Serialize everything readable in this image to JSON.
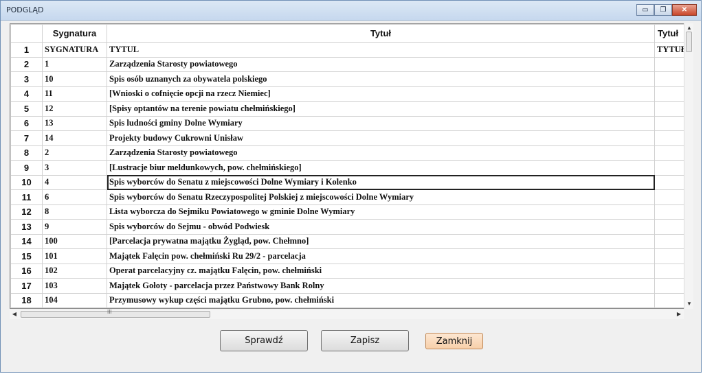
{
  "window": {
    "title": "PODGLĄD"
  },
  "controls": {
    "minimize": "▭",
    "restore": "❐",
    "close": "✕"
  },
  "grid": {
    "headers": [
      "",
      "Sygnatura",
      "Tytuł",
      "Tytuł"
    ],
    "rows": [
      {
        "n": "1",
        "sygnatura": "SYGNATURA",
        "tytul": "TYTUL",
        "extra": "TYTUŁ"
      },
      {
        "n": "2",
        "sygnatura": "1",
        "tytul": "Zarządzenia Starosty powiatowego",
        "extra": ""
      },
      {
        "n": "3",
        "sygnatura": "10",
        "tytul": "Spis osób uznanych za obywatela polskiego",
        "extra": ""
      },
      {
        "n": "4",
        "sygnatura": "11",
        "tytul": "[Wnioski o cofnięcie opcji na rzecz Niemiec]",
        "extra": ""
      },
      {
        "n": "5",
        "sygnatura": "12",
        "tytul": "[Spisy optantów na terenie powiatu chełmińskiego]",
        "extra": ""
      },
      {
        "n": "6",
        "sygnatura": "13",
        "tytul": "Spis ludności gminy Dolne Wymiary",
        "extra": ""
      },
      {
        "n": "7",
        "sygnatura": "14",
        "tytul": "Projekty budowy Cukrowni Unisław",
        "extra": ""
      },
      {
        "n": "8",
        "sygnatura": "2",
        "tytul": "Zarządzenia Starosty powiatowego",
        "extra": ""
      },
      {
        "n": "9",
        "sygnatura": "3",
        "tytul": "[Lustracje biur meldunkowych, pow. chełmińskiego]",
        "extra": ""
      },
      {
        "n": "10",
        "sygnatura": "4",
        "tytul": "Spis wyborców do Senatu z miejscowości Dolne Wymiary i Kolenko",
        "extra": ""
      },
      {
        "n": "11",
        "sygnatura": "6",
        "tytul": "Spis wyborców do Senatu Rzeczypospolitej Polskiej z miejscowości Dolne Wymiary",
        "extra": ""
      },
      {
        "n": "12",
        "sygnatura": "8",
        "tytul": "Lista wyborcza do Sejmiku Powiatowego w gminie Dolne Wymiary",
        "extra": ""
      },
      {
        "n": "13",
        "sygnatura": "9",
        "tytul": "Spis wyborców do Sejmu - obwód Podwiesk",
        "extra": ""
      },
      {
        "n": "14",
        "sygnatura": "100",
        "tytul": "[Parcelacja prywatna majątku Żygląd, pow. Chełmno]",
        "extra": ""
      },
      {
        "n": "15",
        "sygnatura": "101",
        "tytul": "Majątek Falęcin pow. chełmiński Ru 29/2 - parcelacja",
        "extra": ""
      },
      {
        "n": "16",
        "sygnatura": "102",
        "tytul": "Operat parcelacyjny cz. majątku Falęcin, pow. chełmiński",
        "extra": ""
      },
      {
        "n": "17",
        "sygnatura": "103",
        "tytul": "Majątek Gołoty - parcelacja przez Państwowy Bank Rolny",
        "extra": ""
      },
      {
        "n": "18",
        "sygnatura": "104",
        "tytul": "Przymusowy wykup części majątku Grubno, pow. chełmiński",
        "extra": ""
      }
    ],
    "selected_row": "10"
  },
  "scrollbars": {
    "grip": "III"
  },
  "buttons": {
    "check": "Sprawdź",
    "save": "Zapisz",
    "close": "Zamknij"
  }
}
